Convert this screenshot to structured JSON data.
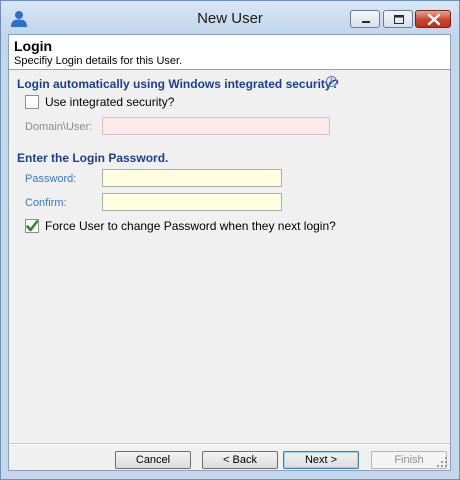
{
  "window": {
    "title": "New User",
    "icons": {
      "app": "user-icon",
      "minimize": "minimize-icon",
      "maximize": "maximize-icon",
      "close": "close-icon"
    }
  },
  "header": {
    "title": "Login",
    "subtitle": "Specifiy Login details for this User."
  },
  "integrated": {
    "heading": "Login automatically using Windows integrated security?",
    "info_icon": "info-icon",
    "checkbox_label": "Use integrated security?",
    "checked": false,
    "domain_label": "Domain\\User:",
    "domain_value": ""
  },
  "password": {
    "heading": "Enter the Login Password.",
    "password_label": "Password:",
    "password_value": "",
    "confirm_label": "Confirm:",
    "confirm_value": "",
    "force_change_label": "Force User to change Password when they next login?",
    "force_change_checked": true
  },
  "buttons": {
    "cancel": "Cancel",
    "back": "< Back",
    "next": "Next >",
    "finish": "Finish"
  },
  "colors": {
    "section_heading": "#1c3f8f",
    "field_label_active": "#3a78c2",
    "required_disabled_field": "#fde8ea",
    "required_field": "#fffde0",
    "checkmark": "#2a8a2a"
  }
}
